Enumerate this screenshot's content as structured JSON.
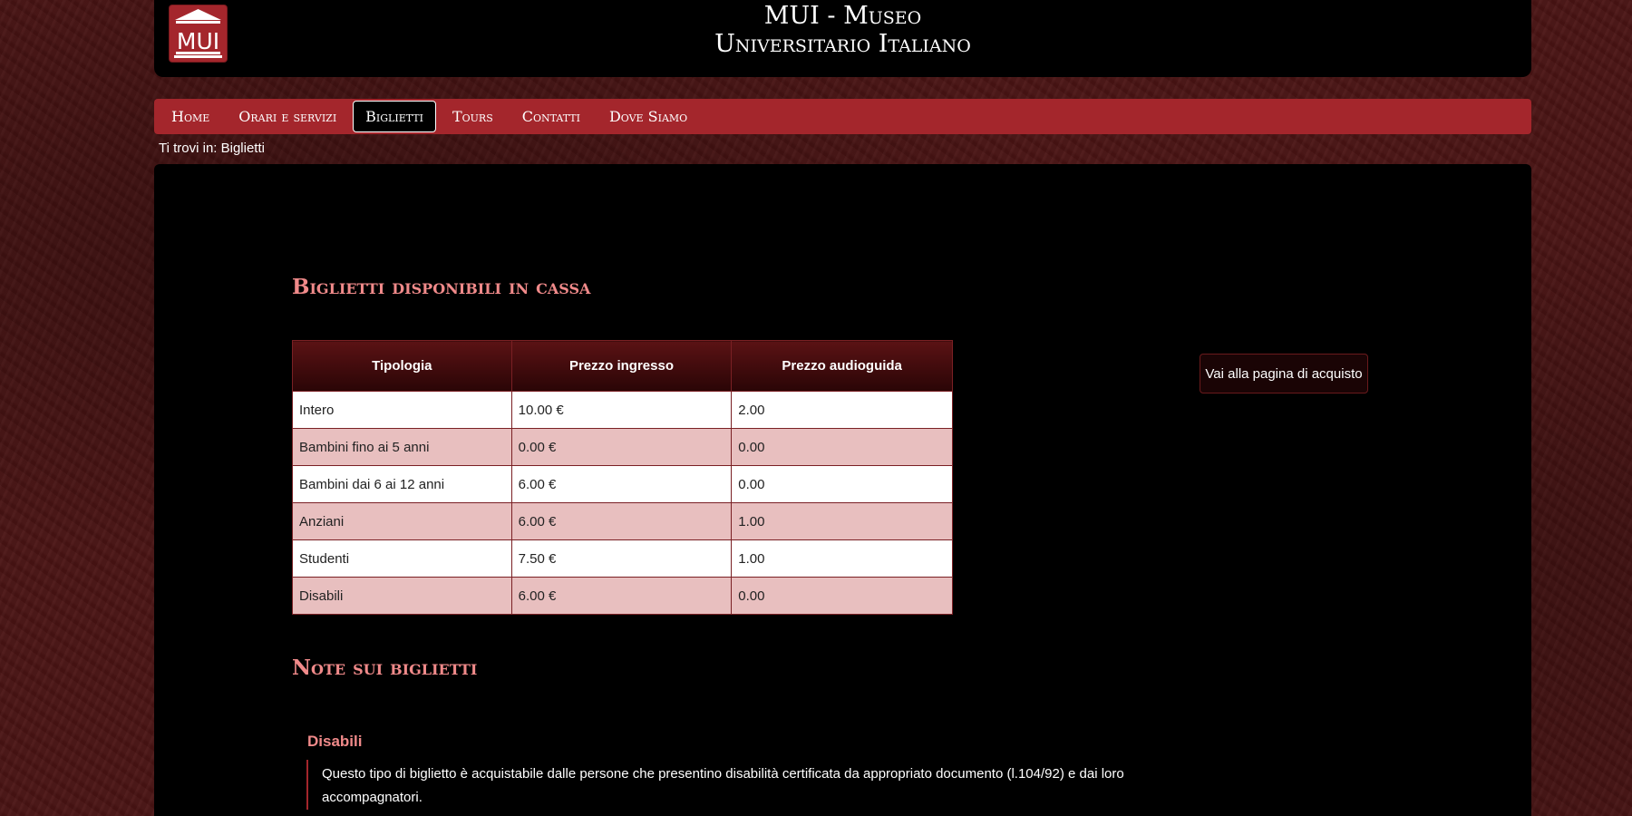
{
  "header": {
    "logo_text": "MUI",
    "title_line1": "MUI - Museo",
    "title_line2": "Universitario Italiano"
  },
  "nav": {
    "items": [
      {
        "label": "Home",
        "active": false
      },
      {
        "label": "Orari e servizi",
        "active": false
      },
      {
        "label": "Biglietti",
        "active": true
      },
      {
        "label": "Tours",
        "active": false
      },
      {
        "label": "Contatti",
        "active": false
      },
      {
        "label": "Dove Siamo",
        "active": false
      }
    ]
  },
  "breadcrumb": "Ti trovi in: Biglietti",
  "main": {
    "section_title": "Biglietti disponibili in cassa",
    "table": {
      "headers": [
        "Tipologia",
        "Prezzo ingresso",
        "Prezzo audioguida"
      ],
      "rows": [
        [
          "Intero",
          "10.00 €",
          "2.00"
        ],
        [
          "Bambini fino ai 5 anni",
          "0.00 €",
          "0.00"
        ],
        [
          "Bambini dai 6 ai 12 anni",
          "6.00 €",
          "0.00"
        ],
        [
          "Anziani",
          "6.00 €",
          "1.00"
        ],
        [
          "Studenti",
          "7.50 €",
          "1.00"
        ],
        [
          "Disabili",
          "6.00 €",
          "0.00"
        ]
      ]
    },
    "buy_button": "Vai alla pagina di acquisto",
    "notes_title": "Note sui biglietti",
    "note": {
      "heading": "Disabili",
      "text": "Questo tipo di biglietto è acquistabile dalle persone che presentino disabilità certificata da appropriato documento (l.104/92) e dai loro accompagnatori."
    }
  },
  "colors": {
    "accent": "#a4262c",
    "heading": "#f08a8a",
    "row_alt": "#e8bfbf"
  }
}
